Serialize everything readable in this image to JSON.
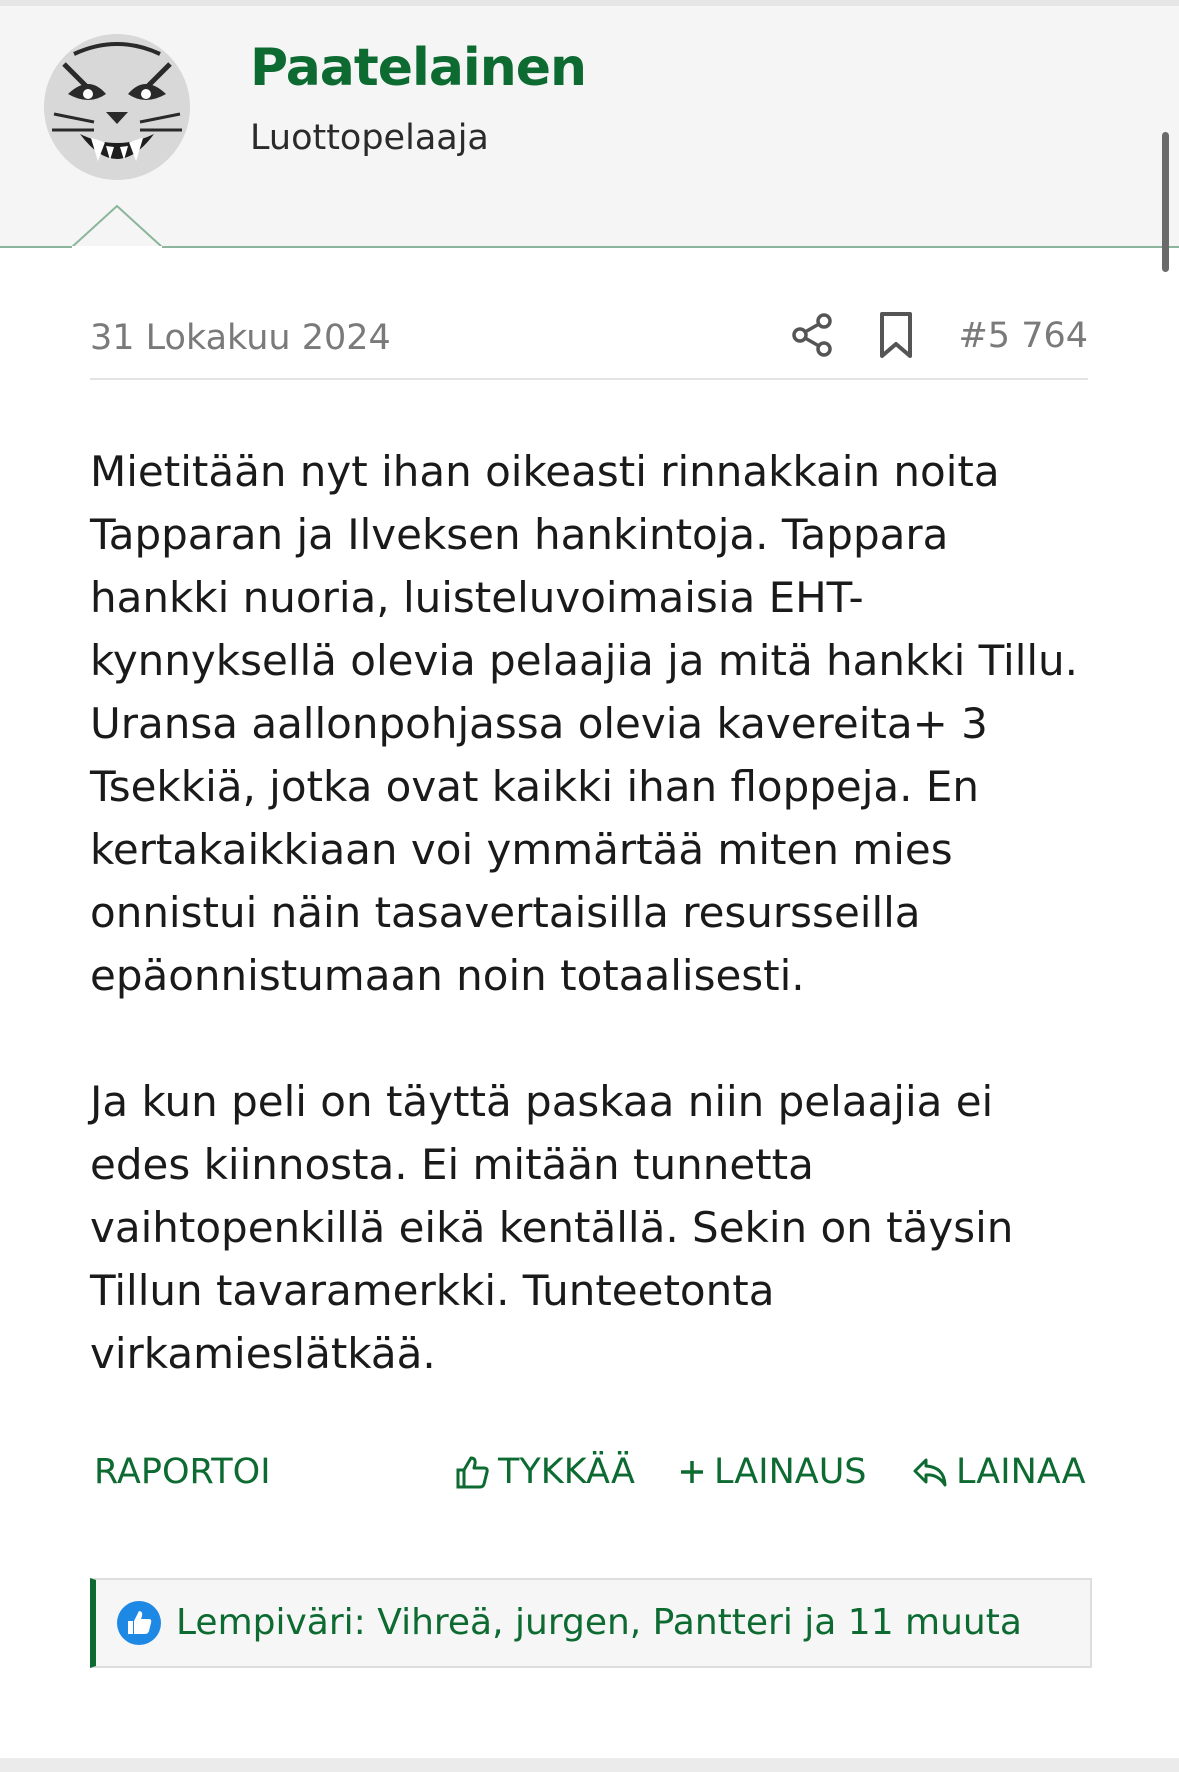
{
  "user": {
    "name": "Paatelainen",
    "title": "Luottopelaaja"
  },
  "post": {
    "date": "31 Lokakuu 2024",
    "number": "#5 764",
    "body": "Mietitään nyt ihan oikeasti rinnakkain noita Tapparan ja Ilveksen hankintoja. Tappara hankki nuoria, luisteluvoimaisia EHT-kynnyksellä olevia pelaajia ja mitä hankki Tillu. Uransa aallonpohjassa olevia kavereita+ 3 Tsekkiä, jotka ovat kaikki ihan floppeja. En kertakaikkiaan voi ymmärtää miten mies onnistui näin tasavertaisilla resursseilla epäonnistumaan noin totaalisesti.\n\nJa kun peli on täyttä paskaa niin pelaajia ei edes kiinnosta. Ei mitään tunnetta vaihtopenkillä eikä kentällä. Sekin on täysin Tillun tavaramerkki. Tunteetonta virkamieslätkää."
  },
  "actions": {
    "report": "RAPORTOI",
    "like": "TYKKÄÄ",
    "multiquote": "LAINAUS",
    "quote": "LAINAA"
  },
  "reactions": {
    "text": "Lempiväri: Vihreä, jurgen, Pantteri ja 11 muuta"
  },
  "icons": {
    "share": "share-icon",
    "bookmark": "bookmark-icon",
    "like": "thumbs-up-icon",
    "multiquote": "plus-icon",
    "quote": "reply-icon",
    "reaction": "like-badge-icon"
  },
  "colors": {
    "accent": "#0d6b32",
    "meta_text": "#7a7a7a",
    "reaction_badge": "#1e88e5"
  }
}
